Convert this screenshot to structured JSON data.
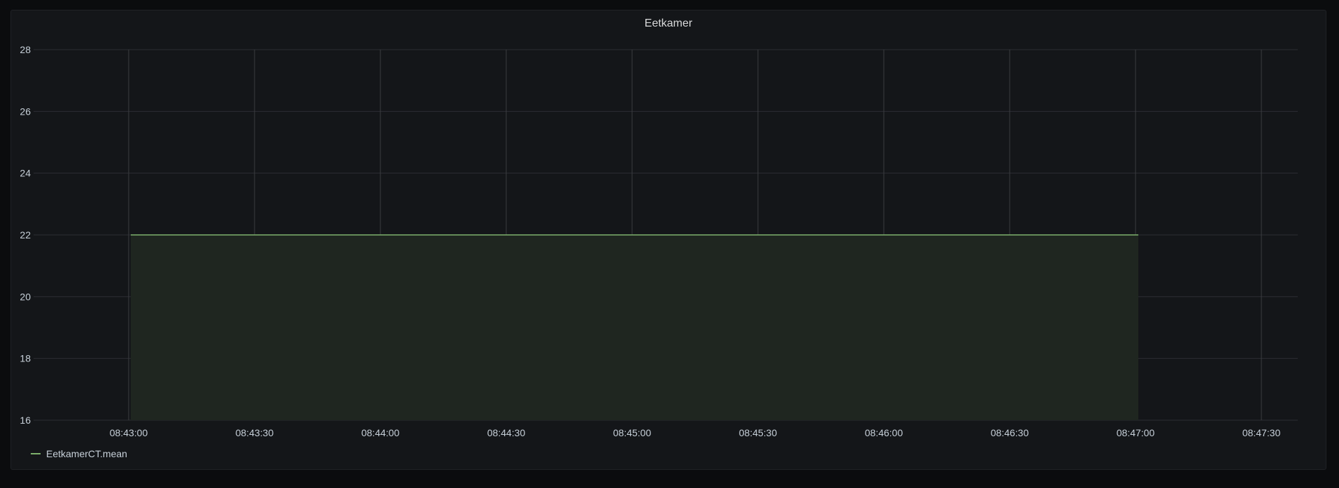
{
  "panel": {
    "title": "Eetkamer"
  },
  "colors": {
    "series": "#7eb26d",
    "fill": "#1f2620",
    "grid": "#2c2e33",
    "vgrid": "#3a3c40",
    "axis_text": "#c7d0d9",
    "background": "#141619"
  },
  "chart_data": {
    "type": "area",
    "title": "Eetkamer",
    "xlabel": "",
    "ylabel": "",
    "ylim": [
      16,
      28
    ],
    "yticks": [
      16,
      18,
      20,
      22,
      24,
      26,
      28
    ],
    "xlim": [
      "08:43:00",
      "08:47:30"
    ],
    "xticks": [
      "08:43:00",
      "08:43:30",
      "08:44:00",
      "08:44:30",
      "08:45:00",
      "08:45:30",
      "08:46:00",
      "08:46:30",
      "08:47:00",
      "08:47:30"
    ],
    "grid": true,
    "legend_position": "bottom-left",
    "series": [
      {
        "name": "EetkamerCT.mean",
        "x": [
          "08:43:00",
          "08:47:00"
        ],
        "values": [
          22,
          22
        ]
      }
    ]
  }
}
